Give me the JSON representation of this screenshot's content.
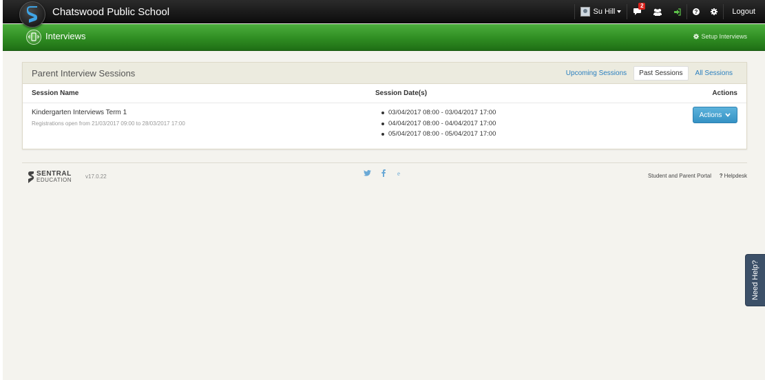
{
  "header": {
    "school_name": "Chatswood Public School",
    "user_name": "Su Hill",
    "messages_count": "2",
    "logout_label": "Logout"
  },
  "module": {
    "title": "Interviews",
    "setup_link": "Setup Interviews"
  },
  "panel": {
    "title": "Parent Interview Sessions",
    "tabs": [
      {
        "label": "Upcoming Sessions",
        "active": false
      },
      {
        "label": "Past Sessions",
        "active": true
      },
      {
        "label": "All Sessions",
        "active": false
      }
    ],
    "columns": {
      "name": "Session Name",
      "dates": "Session Date(s)",
      "actions": "Actions"
    },
    "rows": [
      {
        "name": "Kindergarten Interviews Term 1",
        "registrations": "Registrations open from 21/03/2017 09:00 to 28/03/2017 17:00",
        "dates": [
          "03/04/2017 08:00 - 03/04/2017 17:00",
          "04/04/2017 08:00 - 04/04/2017 17:00",
          "05/04/2017 08:00 - 05/04/2017 17:00"
        ],
        "actions_label": "Actions"
      }
    ]
  },
  "footer": {
    "brand_line1": "SENTRAL",
    "brand_line2": "EDUCATION",
    "version": "v17.0.22",
    "social": [
      "twitter-icon",
      "facebook-icon",
      "edu-icon"
    ],
    "portal_link": "Student and Parent Portal",
    "helpdesk_link": "Helpdesk"
  },
  "need_help": "Need Help?",
  "colors": {
    "top_bar": "#111111",
    "module_bar": "#2f8d22",
    "link": "#2a7fbf",
    "action_button": "#3592c4",
    "help_tab": "#3c5068"
  }
}
